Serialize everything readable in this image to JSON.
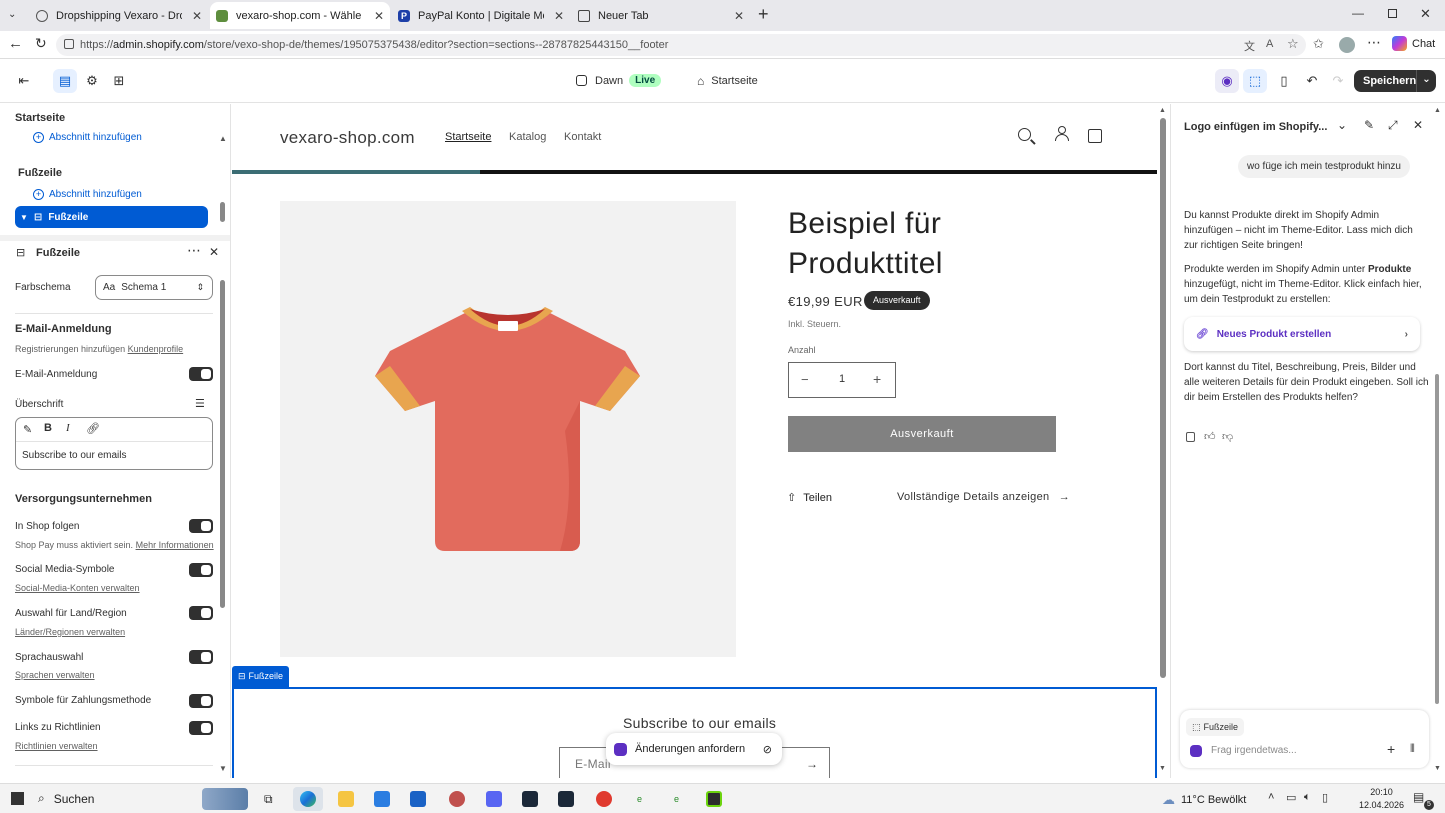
{
  "browser": {
    "tabs": [
      {
        "title": "Dropshipping Vexaro - Dropshipping"
      },
      {
        "title": "vexaro-shop.com - Wähle deinen P"
      },
      {
        "title": "PayPal Konto | Digitale Mobile Wa"
      },
      {
        "title": "Neuer Tab"
      }
    ],
    "url_prefix": "https://",
    "url_domain": "admin.shopify.com",
    "url_path": "/store/vexo-shop-de/themes/195075375438/editor?section=sections--28787825443150__footer",
    "chat_label": "Chat"
  },
  "editor": {
    "theme_name": "Dawn",
    "live_badge": "Live",
    "page_select": "Startseite",
    "save_label": "Speichern"
  },
  "left": {
    "section_title": "Startseite",
    "add_section_1": "Abschnitt hinzufügen",
    "footer_group": "Fußzeile",
    "add_section_2": "Abschnitt hinzufügen",
    "selected_item": "Fußzeile",
    "panel_title": "Fußzeile",
    "color_scheme_label": "Farbschema",
    "color_scheme_value": "Schema 1",
    "email_heading": "E-Mail-Anmeldung",
    "email_sub_text": "Registrierungen hinzufügen",
    "email_sub_link": "Kundenprofile",
    "email_toggle": "E-Mail-Anmeldung",
    "heading_label": "Überschrift",
    "heading_value": "Subscribe to our emails",
    "provider_heading": "Versorgungsunternehmen",
    "follow_label": "In Shop folgen",
    "follow_sub": "Shop Pay muss aktiviert sein.",
    "follow_link": "Mehr Informationen",
    "social_label": "Social Media-Symbole",
    "social_link": "Social-Media-Konten verwalten",
    "country_label": "Auswahl für Land/Region",
    "country_link": "Länder/Regionen verwalten",
    "lang_label": "Sprachauswahl",
    "lang_link": "Sprachen verwalten",
    "payment_label": "Symbole für Zahlungsmethode",
    "policy_label": "Links zu Richtlinien",
    "policy_link": "Richtlinien verwalten"
  },
  "store": {
    "logo": "vexaro-shop.com",
    "nav": [
      "Startseite",
      "Katalog",
      "Kontakt"
    ],
    "product_title_1": "Beispiel für",
    "product_title_2": "Produkttitel",
    "price": "€19,99 EUR",
    "soldout_badge": "Ausverkauft",
    "tax_note": "Inkl. Steuern.",
    "qty_label": "Anzahl",
    "qty_value": "1",
    "soldout_button": "Ausverkauft",
    "share": "Teilen",
    "details": "Vollständige Details anzeigen",
    "footer_tag": "Fußzeile",
    "subscribe_heading": "Subscribe to our emails",
    "email_placeholder": "E-Mail",
    "request_changes": "Änderungen anfordern"
  },
  "chat": {
    "title": "Logo einfügen im Shopify...",
    "user_msg": "wo füge ich mein testprodukt hinzu",
    "reply_1": "Du kannst Produkte direkt im Shopify Admin hinzufügen – nicht im Theme-Editor. Lass mich dich zur richtigen Seite bringen!",
    "reply_2a": "Produkte werden im Shopify Admin unter ",
    "reply_2b": "Produkte",
    "reply_2c": " hinzugefügt, nicht im Theme-Editor. Klick einfach hier, um dein Testprodukt zu erstellen:",
    "link_card": "Neues Produkt erstellen",
    "reply_3": "Dort kannst du Titel, Beschreibung, Preis, Bilder und alle weiteren Details für dein Produkt eingeben. Soll ich dir beim Erstellen des Produkts helfen?",
    "context_chip": "Fußzeile",
    "input_placeholder": "Frag irgendetwas..."
  },
  "taskbar": {
    "search": "Suchen",
    "weather": "11°C  Bewölkt",
    "time": "20:10",
    "date": "12.04.2026",
    "notif_count": "5"
  }
}
